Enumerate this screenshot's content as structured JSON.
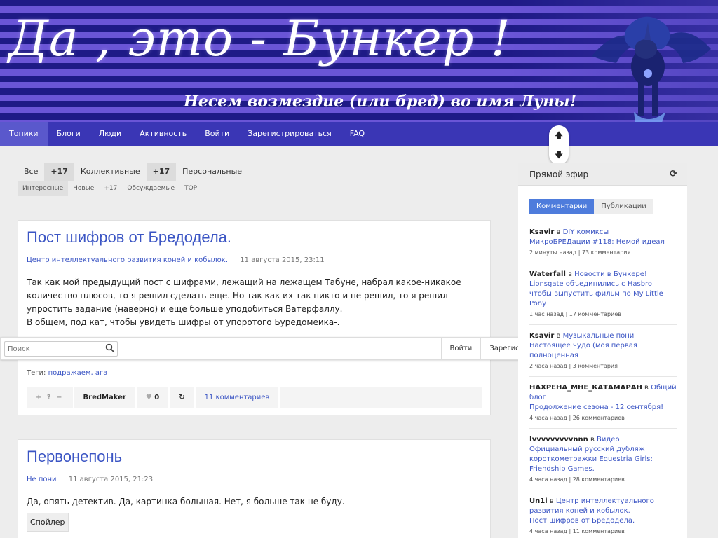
{
  "header": {
    "title": "Да , это  - Бункер !",
    "subtitle": "Несем возмездие (или бред) во имя Луны!"
  },
  "nav": [
    {
      "label": "Топики",
      "active": true
    },
    {
      "label": "Блоги"
    },
    {
      "label": "Люди"
    },
    {
      "label": "Активность"
    },
    {
      "label": "Войти"
    },
    {
      "label": "Зарегистрироваться"
    },
    {
      "label": "FAQ"
    }
  ],
  "filters": [
    "Все",
    "+17",
    "Коллективные",
    "+17",
    "Персональные"
  ],
  "subfilters": [
    "Интересные",
    "Новые",
    "+17",
    "Обсуждаемые",
    "TOP"
  ],
  "posts": [
    {
      "title": "Пост шифров от Бредодела.",
      "blog": "Центр интеллектуального развития коней и кобылок.",
      "date": "11 августа 2015, 23:11",
      "body": [
        "Так как мой предыдущий пост с шифрами, лежащий на лежащем Табуне, набрал какое-никакое количество плюсов, то я решил сделать еще. Но так как их так никто и не решил, то я решил упростить задание (наверно) и еще больше уподобиться Ватерфаллу.",
        "В общем, под кат, чтобы увидеть шифры от упоротого Буредомеика-."
      ],
      "tags_label": "Теги:",
      "tags": "подражаем, ага",
      "vote": "+ ? −",
      "author": "BredMaker",
      "favs": "0",
      "comments": "11 комментариев"
    },
    {
      "title": "Первонепонь",
      "blog": "Не пони",
      "date": "11 августа 2015, 21:23",
      "body": [
        "Да, опять детектив. Да, картинка большая. Нет, я больше так не буду."
      ],
      "spoiler": "Спойлер"
    }
  ],
  "searchbar": {
    "placeholder": "Поиск",
    "login": "Войти",
    "register": "Зарегистрироваться"
  },
  "sidebar": {
    "title": "Прямой эфир",
    "tabs": [
      "Комментарии",
      "Публикации"
    ],
    "feed": [
      {
        "user": "Ksavir",
        "in": "в",
        "blog": "DIY комиксы",
        "topic": "МикроБРЕДации #118: Немой идеал",
        "time": "2 минуты назад | 73 комментария"
      },
      {
        "user": "Waterfall",
        "in": "в",
        "blog": "Новости в Бункере!",
        "topic": "Lionsgate объединились с Hasbro чтобы выпустить фильм по My Little Pony",
        "time": "1 час назад | 17 комментариев"
      },
      {
        "user": "Ksavir",
        "in": "в",
        "blog": "Музыкальные пони",
        "topic": "Настоящее чудо (моя первая полноценная",
        "time": "2 часа назад | 3 комментария"
      },
      {
        "user": "НАХРЕНА_МНЕ_КАТАМАРАН",
        "in": "в",
        "blog": "Общий блог",
        "topic": "Продолжение сезона - 12 сентября!",
        "time": "4 часа назад | 26 комментариев"
      },
      {
        "user": "Ivvvvvvvvvnnn",
        "in": "в",
        "blog": "Видео",
        "topic": "Официальный русский дубляж короткометражки Equestria Girls: Friendship Games.",
        "time": "4 часа назад | 28 комментариев"
      },
      {
        "user": "Un1i",
        "in": "в",
        "blog": "Центр интеллектуального развития коней и кобылок.",
        "topic": "Пост шифров от Бредодела.",
        "time": "4 часа назад | 11 комментариев"
      }
    ]
  }
}
